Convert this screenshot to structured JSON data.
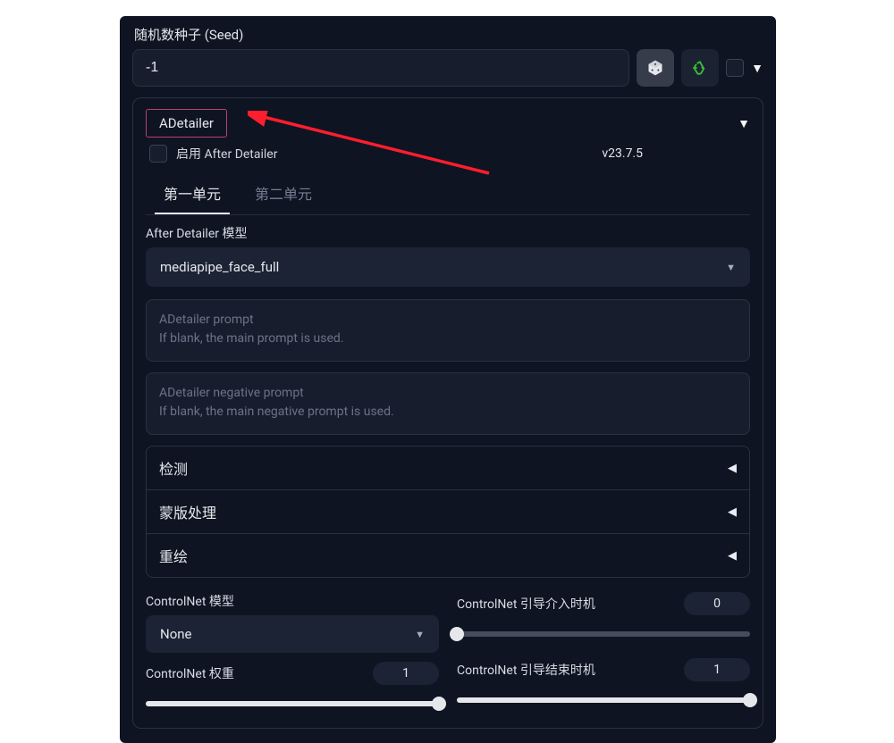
{
  "seed": {
    "label": "随机数种子 (Seed)",
    "value": "-1"
  },
  "adetailer": {
    "title": "ADetailer",
    "enable_label": "启用 After Detailer",
    "version": "v23.7.5",
    "tabs": [
      "第一单元",
      "第二单元"
    ],
    "model_label": "After Detailer 模型",
    "model_value": "mediapipe_face_full",
    "prompt_placeholder_line1": "ADetailer prompt",
    "prompt_placeholder_line2": "If blank, the main prompt is used.",
    "neg_placeholder_line1": "ADetailer negative prompt",
    "neg_placeholder_line2": "If blank, the main negative prompt is used.",
    "accordion": [
      "检测",
      "蒙版处理",
      "重绘"
    ],
    "controlnet": {
      "model_label": "ControlNet 模型",
      "model_value": "None",
      "weight_label": "ControlNet 权重",
      "weight_value": "1",
      "start_label": "ControlNet 引导介入时机",
      "start_value": "0",
      "end_label": "ControlNet 引导结束时机",
      "end_value": "1"
    }
  }
}
